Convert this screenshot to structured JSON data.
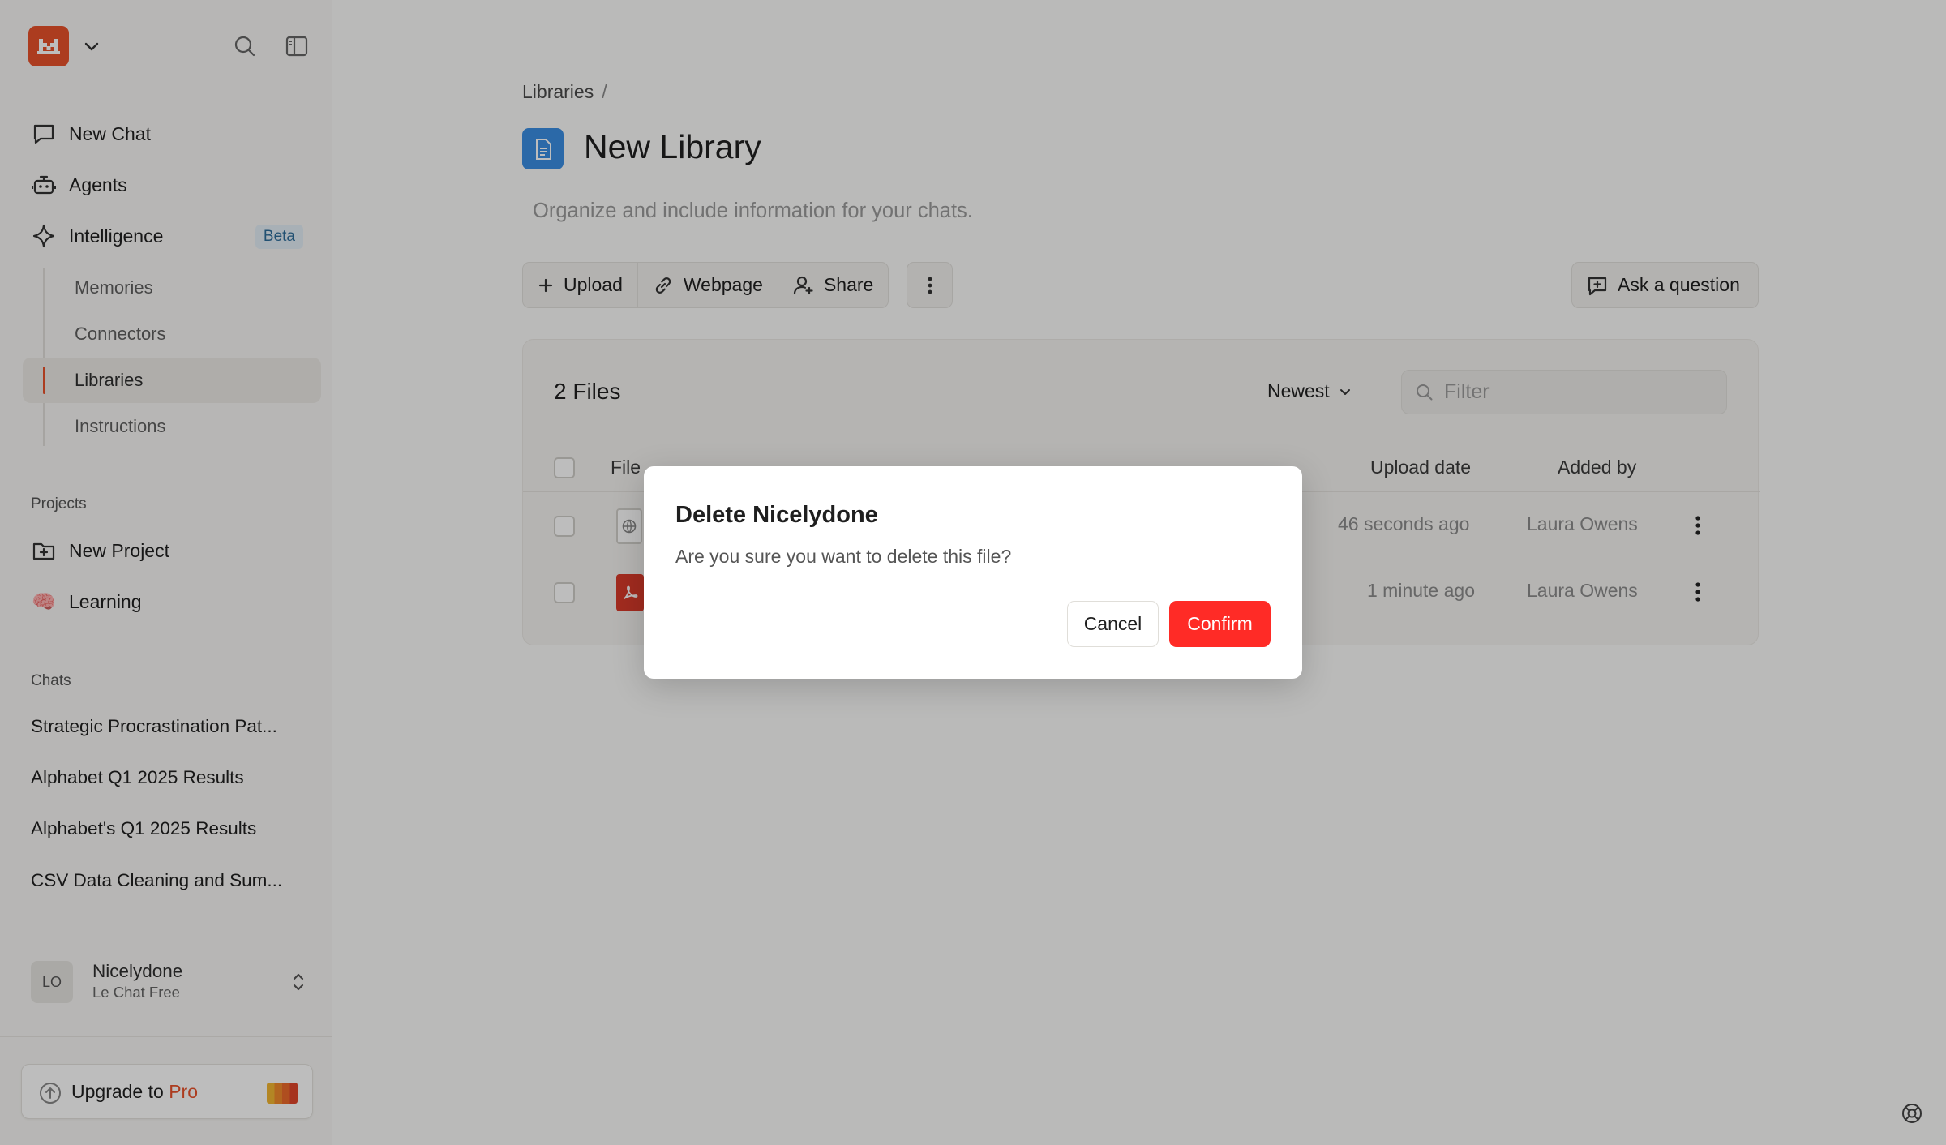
{
  "sidebar": {
    "nav": [
      {
        "label": "New Chat",
        "icon": "chat-bubble-icon"
      },
      {
        "label": "Agents",
        "icon": "robot-icon"
      },
      {
        "label": "Intelligence",
        "icon": "sparkle-icon",
        "badge": "Beta"
      }
    ],
    "intelligence_sub": [
      {
        "label": "Memories"
      },
      {
        "label": "Connectors"
      },
      {
        "label": "Libraries",
        "active": true
      },
      {
        "label": "Instructions"
      }
    ],
    "projects_label": "Projects",
    "projects": [
      {
        "label": "New Project",
        "icon": "folder-plus-icon"
      },
      {
        "label": "Learning",
        "icon": "brain-emoji",
        "emoji": "🧠"
      }
    ],
    "chats_label": "Chats",
    "chats": [
      "Strategic Procrastination Pat...",
      "Alphabet Q1 2025 Results",
      "Alphabet's Q1 2025 Results",
      "CSV Data Cleaning and Sum..."
    ],
    "user": {
      "initials": "LO",
      "name": "Nicelydone",
      "plan": "Le Chat Free"
    },
    "upgrade": {
      "prefix": "Upgrade to ",
      "highlight": "Pro"
    }
  },
  "main": {
    "breadcrumb": {
      "item": "Libraries",
      "separator": "/"
    },
    "title": "New Library",
    "description": "Organize and include information for your chats.",
    "toolbar": {
      "upload": "Upload",
      "webpage": "Webpage",
      "share": "Share",
      "ask": "Ask a question"
    },
    "files": {
      "count_label": "2 Files",
      "sort_label": "Newest",
      "filter_placeholder": "Filter",
      "columns": {
        "file": "File",
        "upload_date": "Upload date",
        "added_by": "Added by"
      },
      "rows": [
        {
          "type": "webpage",
          "upload_date": "46 seconds ago",
          "added_by": "Laura Owens"
        },
        {
          "type": "pdf",
          "upload_date": "1 minute ago",
          "added_by": "Laura Owens"
        }
      ]
    }
  },
  "modal": {
    "title": "Delete Nicelydone",
    "message": "Are you sure you want to delete this file?",
    "cancel": "Cancel",
    "confirm": "Confirm"
  },
  "colors": {
    "brand": "#e8512b",
    "confirm": "#ff2b26",
    "library_icon": "#3b8ee3"
  }
}
